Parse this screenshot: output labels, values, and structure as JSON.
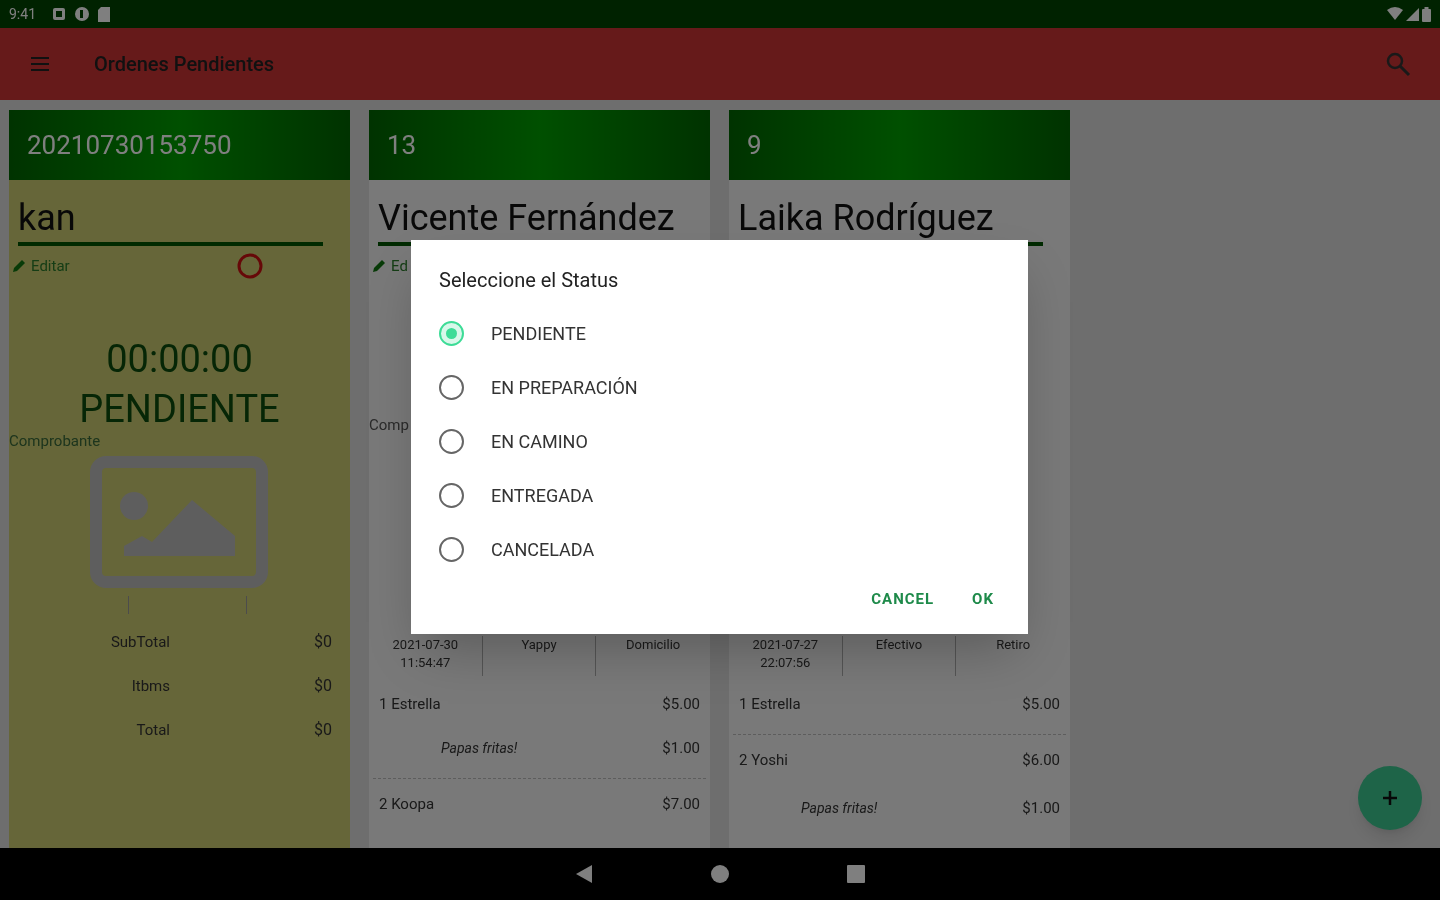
{
  "status_bar": {
    "time": "9:41"
  },
  "app_bar": {
    "title": "Ordenes Pendientes"
  },
  "orders": [
    {
      "kind": "full",
      "highlighted": true,
      "number": "20210730153750",
      "customer": "kan",
      "edit": "Editar",
      "timer": "00:00:00",
      "status": "PENDIENTE",
      "receipt_label": "Comprobante",
      "totals": [
        {
          "label": "SubTotal",
          "value": "$0"
        },
        {
          "label": "Itbms",
          "value": "$0"
        },
        {
          "label": "Total",
          "value": "$0"
        }
      ]
    },
    {
      "kind": "covered",
      "highlighted": false,
      "number": "13",
      "customer": "Vicente Fernández",
      "edit": "Ed",
      "receipt_label": "Comp",
      "details": [
        [
          "2021-07-30",
          "11:54:47"
        ],
        [
          "Yappy"
        ],
        [
          "Domicilio"
        ]
      ],
      "items": [
        {
          "kind": "item",
          "qty": "1",
          "name": "Estrella",
          "price": "$5.00"
        },
        {
          "kind": "extra",
          "name": "Papas fritas!",
          "price": "$1.00"
        },
        {
          "kind": "item",
          "qty": "2",
          "name": "Koopa",
          "price": "$7.00"
        }
      ]
    },
    {
      "kind": "covered",
      "highlighted": false,
      "number": "9",
      "customer": "Laika Rodríguez",
      "details": [
        [
          "2021-07-27",
          "22:07:56"
        ],
        [
          "Efectivo"
        ],
        [
          "Retiro"
        ]
      ],
      "items": [
        {
          "kind": "item",
          "qty": "1",
          "name": "Estrella",
          "price": "$5.00"
        },
        {
          "kind": "item",
          "qty": "2",
          "name": "Yoshi",
          "price": "$6.00"
        },
        {
          "kind": "extra",
          "name": "Papas fritas!",
          "price": "$1.00"
        }
      ]
    }
  ],
  "dialog": {
    "title": "Seleccione el Status",
    "options": [
      {
        "label": "PENDIENTE",
        "selected": true
      },
      {
        "label": "EN PREPARACIÓN",
        "selected": false
      },
      {
        "label": "EN CAMINO",
        "selected": false
      },
      {
        "label": "ENTREGADA",
        "selected": false
      },
      {
        "label": "CANCELADA",
        "selected": false
      }
    ],
    "buttons": [
      "CANCEL",
      "OK"
    ]
  }
}
